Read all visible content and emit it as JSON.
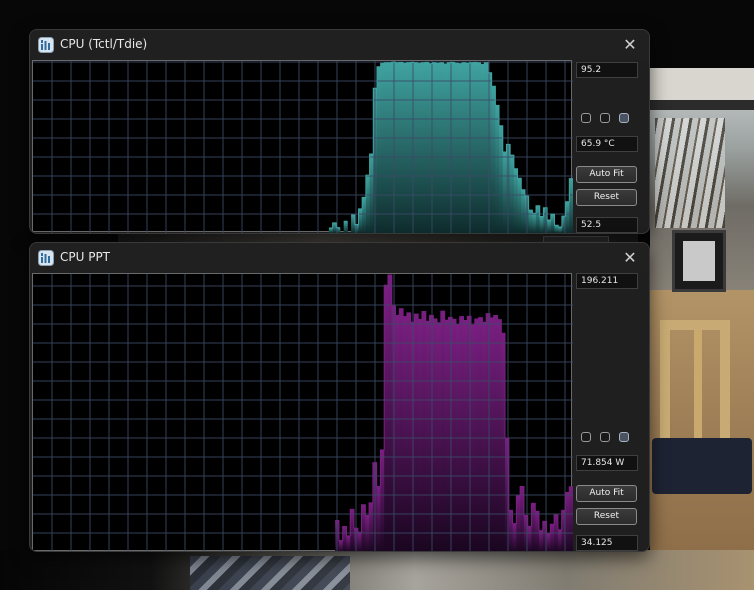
{
  "windows": [
    {
      "title": "CPU (Tctl/Tdie)",
      "close_glyph": "✕",
      "icon": "graph-app-icon",
      "max_label": "95.2",
      "current_label": "65.9 °C",
      "min_label": "52.5",
      "auto_fit_label": "Auto Fit",
      "reset_label": "Reset",
      "color": "#3fa3a0",
      "color_dark": "#0f2c2d"
    },
    {
      "title": "CPU PPT",
      "close_glyph": "✕",
      "icon": "graph-app-icon",
      "max_label": "196.211",
      "current_label": "71.854 W",
      "min_label": "34.125",
      "auto_fit_label": "Auto Fit",
      "reset_label": "Reset",
      "color": "#7a1f82",
      "color_dark": "#1a0620"
    }
  ],
  "chart_data": [
    {
      "type": "area",
      "ylim": [
        52.5,
        95.2
      ],
      "series": [
        {
          "values": [
            null,
            null,
            null,
            null,
            null,
            null,
            null,
            null,
            null,
            null,
            null,
            null,
            null,
            null,
            null,
            null,
            null,
            null,
            null,
            null,
            null,
            null,
            null,
            null,
            null,
            null,
            null,
            null,
            null,
            null,
            null,
            null,
            null,
            null,
            null,
            null,
            null,
            null,
            null,
            null,
            null,
            null,
            null,
            null,
            null,
            null,
            null,
            null,
            null,
            null,
            null,
            null,
            null,
            null,
            null,
            null,
            null,
            null,
            null,
            null,
            null,
            null,
            null,
            null,
            null,
            null,
            null,
            null,
            null,
            null,
            null,
            null,
            null,
            null,
            null,
            null,
            null,
            null,
            null,
            null,
            53.5,
            54.8,
            53.6,
            null,
            55.2,
            null,
            56.8,
            54.4,
            58.3,
            61.2,
            66.8,
            72.1,
            88.6,
            94.0,
            94.9,
            95.0,
            95.0,
            95.2,
            95.0,
            95.1,
            94.9,
            95.0,
            95.1,
            95.0,
            94.9,
            95.0,
            95.1,
            94.8,
            95.0,
            94.9,
            95.0,
            94.7,
            95.0,
            95.1,
            94.9,
            94.8,
            95.0,
            94.9,
            95.0,
            95.1,
            95.0,
            94.6,
            95.0,
            92.5,
            89.1,
            84.3,
            79.2,
            72.6,
            74.5,
            71.8,
            68.4,
            66.0,
            63.1,
            61.5,
            58.0,
            57.2,
            59.1,
            56.4,
            58.6,
            55.5,
            57.0,
            54.2,
            53.8,
            56.5,
            60.1,
            65.9
          ]
        }
      ]
    },
    {
      "type": "area",
      "ylim": [
        34.125,
        196.211
      ],
      "series": [
        {
          "values": [
            null,
            null,
            null,
            null,
            null,
            null,
            null,
            null,
            null,
            null,
            null,
            null,
            null,
            null,
            null,
            null,
            null,
            null,
            null,
            null,
            null,
            null,
            null,
            null,
            null,
            null,
            null,
            null,
            null,
            null,
            null,
            null,
            null,
            null,
            null,
            null,
            null,
            null,
            null,
            null,
            null,
            null,
            null,
            null,
            null,
            null,
            null,
            null,
            null,
            null,
            null,
            null,
            null,
            null,
            null,
            null,
            null,
            null,
            null,
            null,
            null,
            null,
            null,
            null,
            null,
            null,
            null,
            null,
            null,
            null,
            null,
            null,
            null,
            null,
            null,
            null,
            null,
            null,
            null,
            null,
            52.0,
            40.2,
            48.5,
            43.0,
            58.6,
            47.5,
            45.2,
            61.3,
            55.0,
            62.4,
            86.0,
            72.0,
            93.5,
            190.2,
            196.2,
            178.0,
            172.5,
            176.4,
            171.8,
            174.0,
            168.5,
            173.2,
            170.1,
            174.8,
            169.0,
            172.5,
            170.4,
            168.2,
            175.0,
            169.6,
            171.3,
            170.2,
            167.0,
            171.8,
            169.5,
            172.0,
            166.8,
            170.4,
            171.2,
            168.5,
            173.5,
            171.0,
            172.4,
            170.0,
            162.0,
            100.5,
            58.0,
            50.2,
            66.5,
            72.0,
            55.0,
            48.6,
            62.1,
            57.4,
            46.0,
            51.5,
            44.2,
            49.8,
            55.3,
            46.5,
            58.0,
            68.5,
            71.854
          ]
        }
      ]
    }
  ]
}
